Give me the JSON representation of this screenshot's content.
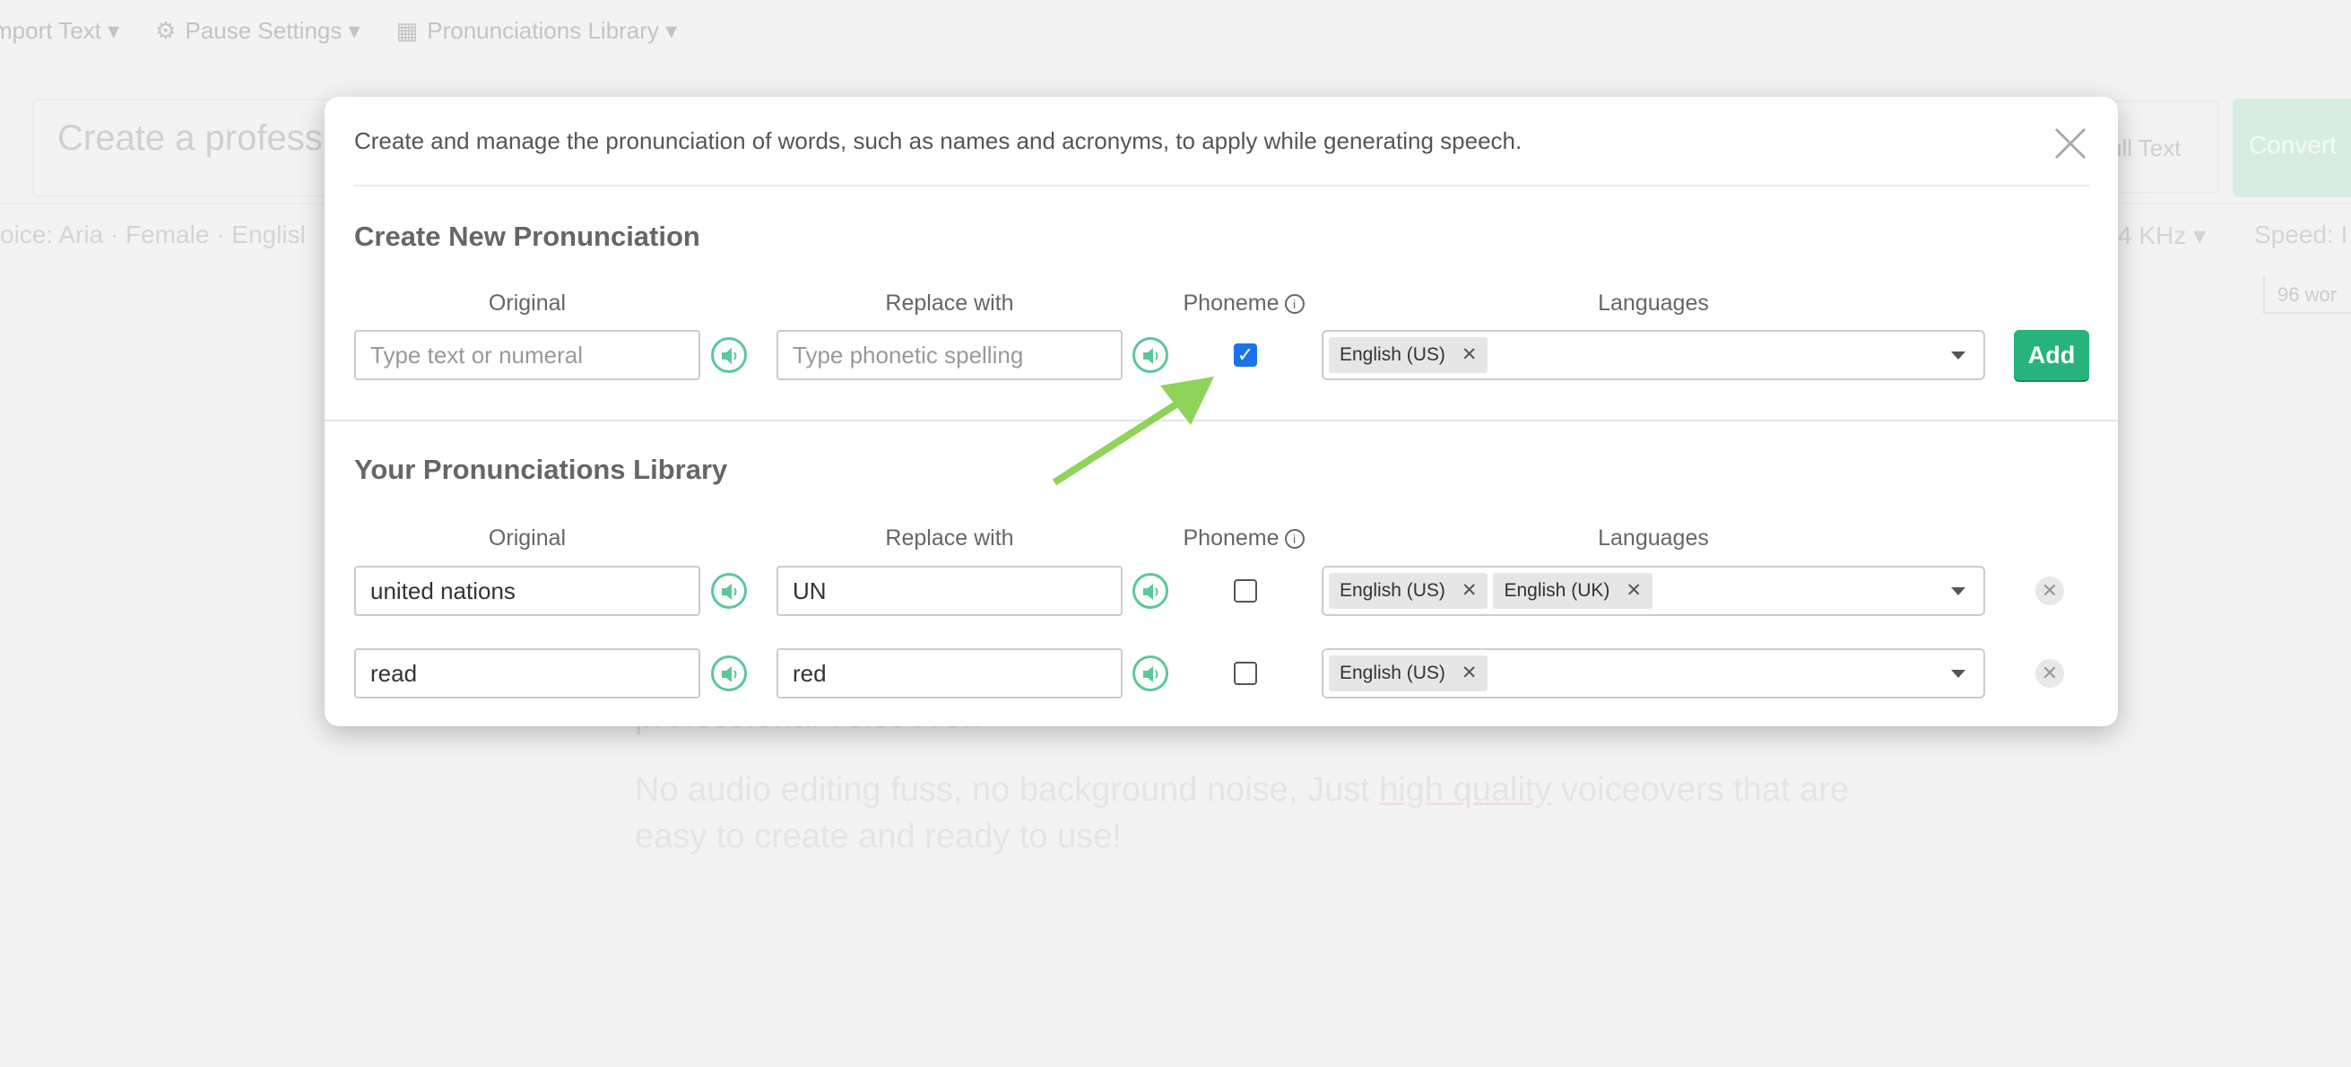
{
  "background": {
    "menu": [
      {
        "label": "mport Text ▾",
        "icon": "none"
      },
      {
        "label": "Pause Settings ▾",
        "icon": "gear-icon"
      },
      {
        "label": "Pronunciations Library ▾",
        "icon": "grid-icon"
      }
    ],
    "title_placeholder": "Create a professio",
    "full_text_button": "ull Text",
    "convert_button": "Convert",
    "voice": "oice: Aria · Female · Englisl",
    "sample_rate": "4 KHz ▾",
    "speed": "Speed: I",
    "word_count": "96 wor",
    "partial_line": "professional voiceover.",
    "body_text_before": "No audio editing fuss, no background noise, Just ",
    "body_text_highlight": "high quality",
    "body_text_after": " voiceovers that are easy to create and ready to use!"
  },
  "modal": {
    "description": "Create and manage the pronunciation of words, such as names and acronyms, to apply while generating speech.",
    "create_section": {
      "title": "Create New Pronunciation",
      "headers": {
        "original": "Original",
        "replace": "Replace with",
        "phoneme": "Phoneme",
        "languages": "Languages"
      },
      "original_placeholder": "Type text or numeral",
      "replace_placeholder": "Type phonetic spelling",
      "phoneme_checked": true,
      "languages": [
        "English (US)"
      ],
      "add_label": "Add"
    },
    "library_section": {
      "title": "Your Pronunciations Library",
      "headers": {
        "original": "Original",
        "replace": "Replace with",
        "phoneme": "Phoneme",
        "languages": "Languages"
      },
      "rows": [
        {
          "original": "united nations",
          "replace": "UN",
          "phoneme": false,
          "languages": [
            "English (US)",
            "English (UK)"
          ]
        },
        {
          "original": "read",
          "replace": "red",
          "phoneme": false,
          "languages": [
            "English (US)"
          ]
        }
      ]
    }
  },
  "colors": {
    "accent": "#26b47a",
    "speaker": "#5cc79a",
    "checkbox": "#1a73e8",
    "arrow": "#8fd35a"
  }
}
